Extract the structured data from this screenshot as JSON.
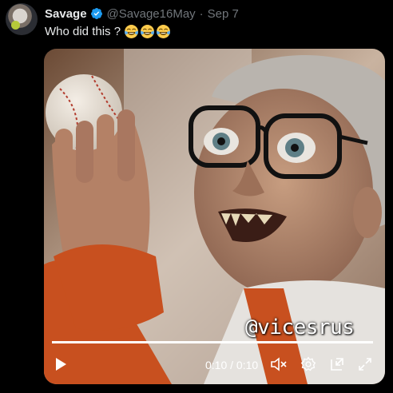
{
  "tweet": {
    "author_name": "Savage",
    "handle": "@Savage16May",
    "separator": "·",
    "date": "Sep 7",
    "text": "Who did this ?",
    "emojis": [
      "face-with-tears-of-joy",
      "face-with-tears-of-joy",
      "face-with-tears-of-joy"
    ]
  },
  "media": {
    "watermark": "@vicesrus",
    "progress": 1.0,
    "current_time": "0:10",
    "time_separator": "/",
    "duration": "0:10",
    "icons": [
      "play-icon",
      "volume-muted-icon",
      "settings-icon",
      "minimize-icon",
      "fullscreen-icon"
    ]
  },
  "colors": {
    "background": "#000000",
    "text": "#e7e9ea",
    "muted": "#71767b",
    "verified": "#1d9bf0"
  }
}
